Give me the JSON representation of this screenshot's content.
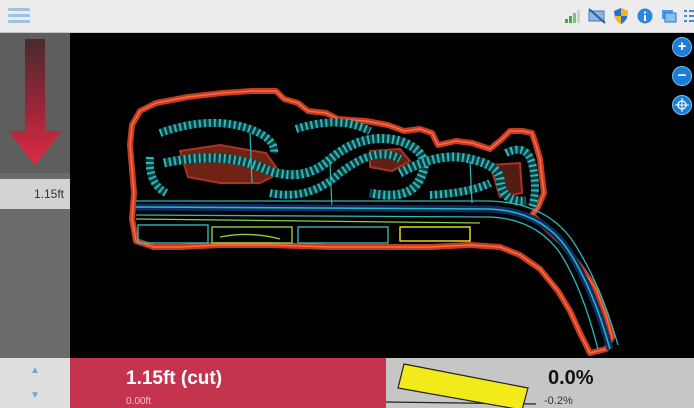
{
  "topbar": {
    "menu_icon": "hamburger-menu-icon",
    "status_icons": [
      "signal-strength-icon",
      "no-radio-link-icon",
      "shield-icon",
      "info-icon",
      "sync-icon",
      "list-icon"
    ]
  },
  "left_panel": {
    "direction_icon": "down-arrow-icon",
    "design_depth": "1.15ft"
  },
  "map_controls": {
    "zoom_in_label": "+",
    "zoom_out_label": "−",
    "zoom_extents_icon": "zoom-extents-icon"
  },
  "bottom": {
    "stepper_up_icon": "▲",
    "stepper_down_icon": "▼",
    "cut_value": "1.15ft (cut)",
    "offset_value": "0.00ft",
    "cross_slope": "0.0%",
    "design_slope": "-0.2%"
  },
  "colors": {
    "cut_panel": "#c4344f",
    "cut_arrow": "#d0243e",
    "plan_lines": "#2fb8b8",
    "surface": "#e8462a",
    "blade": "#f2ea1b",
    "button_blue": "#1b7ed6"
  }
}
